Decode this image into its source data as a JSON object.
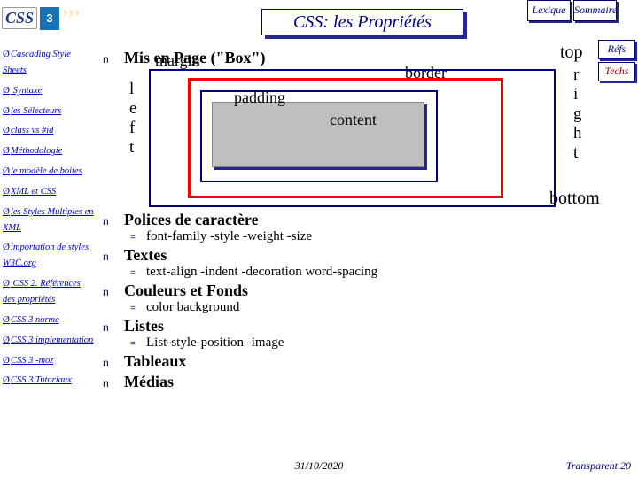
{
  "header": {
    "title": "CSS: les Propriétés",
    "lexique": "Lexique",
    "sommaire": "Sommaire",
    "refs": "Réfs",
    "techs": "Techs",
    "logo_text": "CSS",
    "logo3": "3",
    "quotes": "’’’"
  },
  "sidebar": {
    "items": [
      "Cascading Style Sheets",
      " Syntaxe",
      "les Sélecteurs",
      "class vs #id",
      "Méthodologie",
      "le modèle de boites",
      "XML et CSS",
      "les Styles Multiples en XML",
      "importation de styles W3C.org",
      " CSS 2. Références des propriétés",
      "CSS 3 norme",
      "CSS 3 implementation",
      "CSS 3 -moz",
      "CSS 3 Tutoriaux"
    ]
  },
  "content": {
    "s1": {
      "n": "n",
      "title": "Mis en Page (\"Box\")"
    },
    "box": {
      "margin": "margin",
      "border": "border",
      "padding": "padding",
      "content": "content",
      "top": "top",
      "bottom": "bottom",
      "left": "l\ne\nf\nt",
      "right": "r\ni\ng\nh\nt"
    },
    "s2": {
      "n": "n",
      "title": "Polices de caractère",
      "sub_n": "=",
      "sub": "font-family -style -weight -size"
    },
    "s3": {
      "n": "n",
      "title": "Textes",
      "sub_n": "=",
      "sub": "text-align -indent -decoration word-spacing"
    },
    "s4": {
      "n": "n",
      "title": "Couleurs et Fonds",
      "sub_n": "=",
      "sub": "color  background"
    },
    "s5": {
      "n": "n",
      "title": "Listes",
      "sub_n": "=",
      "sub": "List-style-position -image"
    },
    "s6": {
      "n": "n",
      "title": "Tableaux"
    },
    "s7": {
      "n": "n",
      "title": "Médias"
    }
  },
  "footer": {
    "date": "31/10/2020",
    "page": "Transparent 20"
  }
}
